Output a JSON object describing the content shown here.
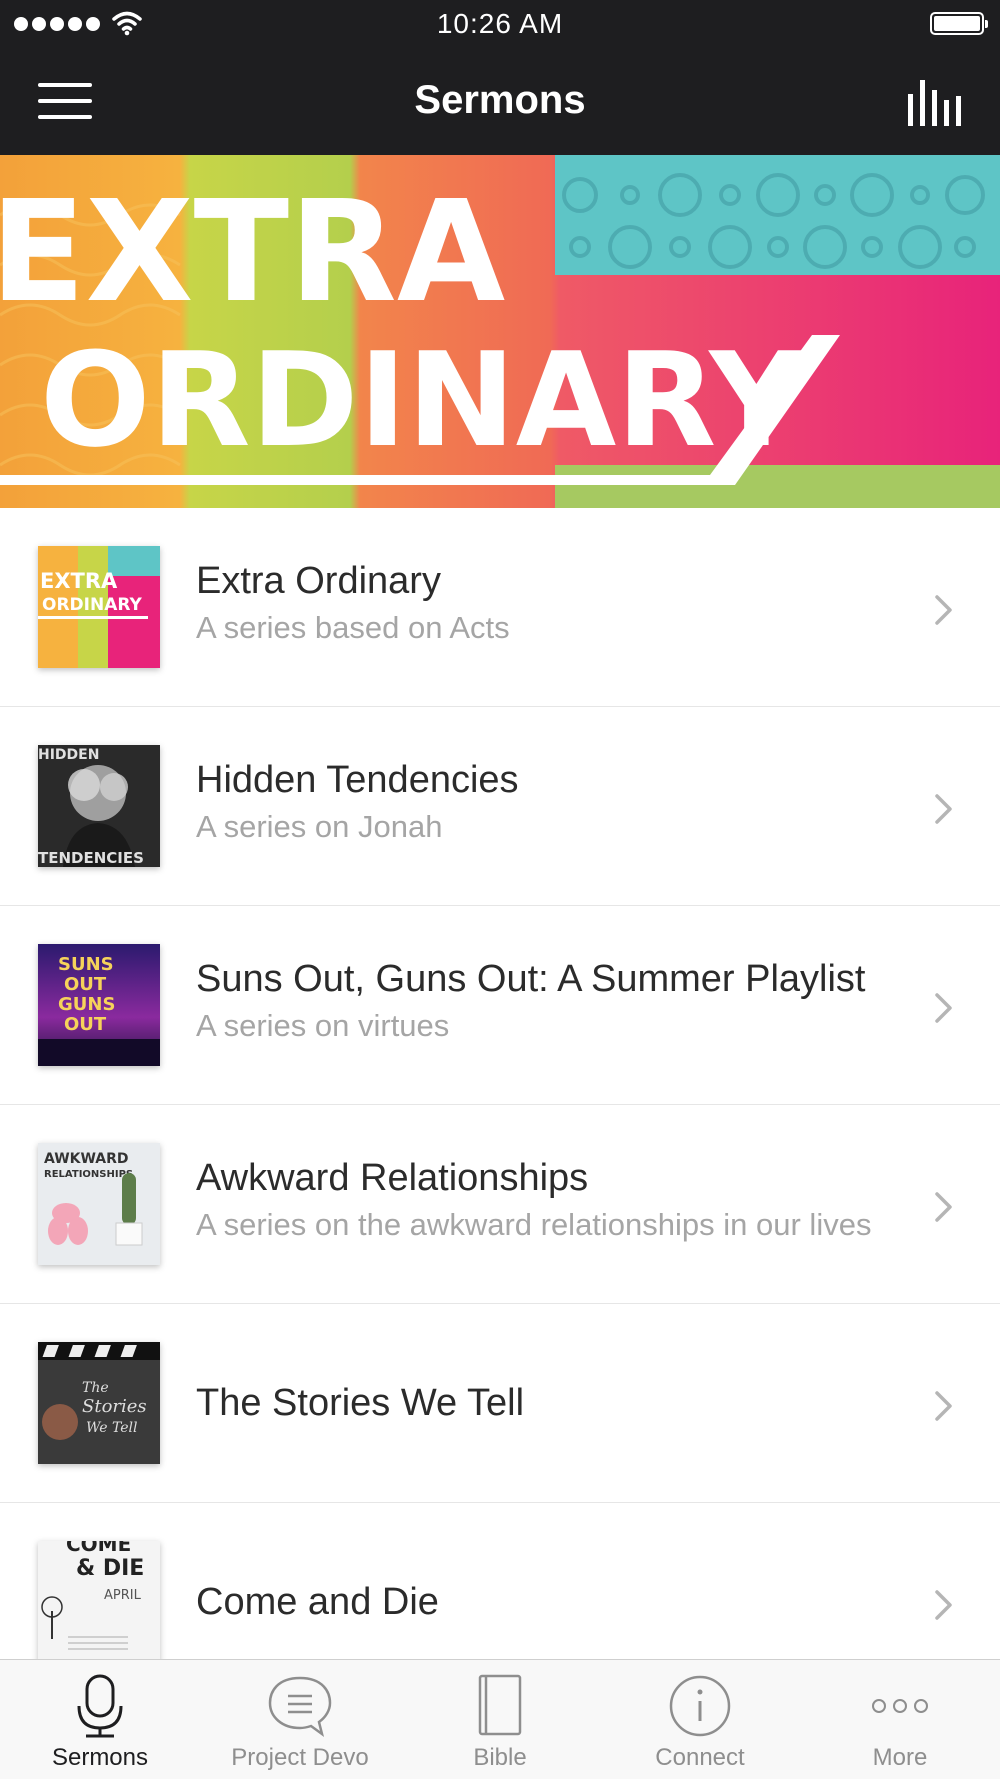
{
  "status_bar": {
    "time": "10:26 AM"
  },
  "nav": {
    "title": "Sermons"
  },
  "banner": {
    "line1": "EXTRA",
    "line2": "ORDINARY"
  },
  "series": [
    {
      "title": "Extra Ordinary",
      "subtitle": "A series based on Acts",
      "thumb_text": [
        "EXTRA",
        "ORDINARY"
      ]
    },
    {
      "title": "Hidden Tendencies",
      "subtitle": "A series on Jonah",
      "thumb_text": [
        "HIDDEN",
        "TENDENCIES"
      ]
    },
    {
      "title": "Suns Out, Guns Out: A Summer Playlist",
      "subtitle": "A series on virtues",
      "thumb_text": [
        "SUNS",
        "OUT",
        "GUNS",
        "OUT"
      ]
    },
    {
      "title": "Awkward Relationships",
      "subtitle": "A series on the awkward relationships in our lives",
      "thumb_text": [
        "AWKWARD",
        "RELATIONSHIPS"
      ]
    },
    {
      "title": "The Stories We Tell",
      "subtitle": "",
      "thumb_text": [
        "The",
        "Stories",
        "We Tell"
      ]
    },
    {
      "title": "Come and Die",
      "subtitle": "",
      "thumb_text": [
        "COME",
        "& DIE",
        "APRIL"
      ]
    }
  ],
  "tabs": [
    {
      "label": "Sermons",
      "icon": "microphone-icon",
      "active": true
    },
    {
      "label": "Project Devo",
      "icon": "chat-bubble-icon",
      "active": false
    },
    {
      "label": "Bible",
      "icon": "book-icon",
      "active": false
    },
    {
      "label": "Connect",
      "icon": "info-icon",
      "active": false
    },
    {
      "label": "More",
      "icon": "more-dots-icon",
      "active": false
    }
  ],
  "colors": {
    "bar": "#1e1e20",
    "muted": "#a5a5a5",
    "text": "#2b2b2b",
    "tab_inactive": "#8e8e8e"
  }
}
